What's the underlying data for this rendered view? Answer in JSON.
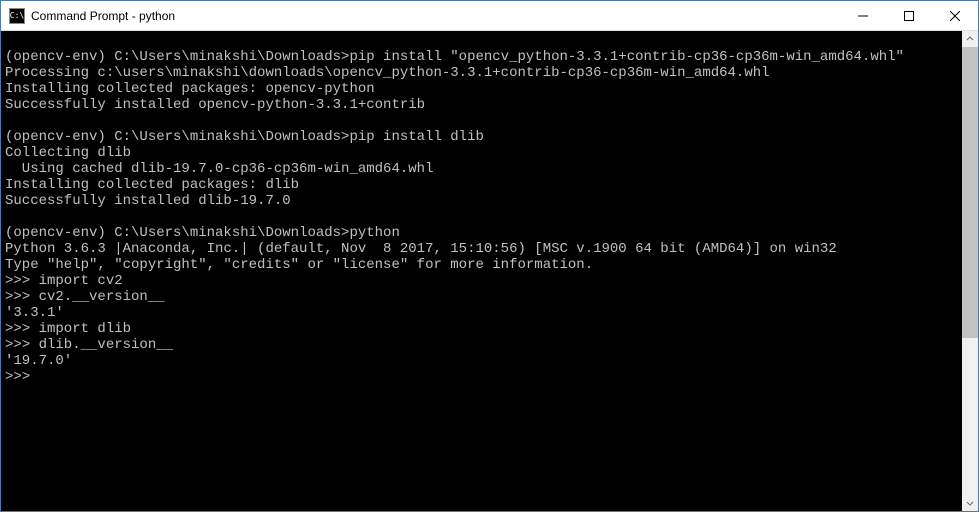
{
  "titlebar": {
    "icon_text": "C:\\",
    "title": "Command Prompt - python"
  },
  "terminal": {
    "lines": [
      "",
      "(opencv-env) C:\\Users\\minakshi\\Downloads>pip install \"opencv_python-3.3.1+contrib-cp36-cp36m-win_amd64.whl\"",
      "Processing c:\\users\\minakshi\\downloads\\opencv_python-3.3.1+contrib-cp36-cp36m-win_amd64.whl",
      "Installing collected packages: opencv-python",
      "Successfully installed opencv-python-3.3.1+contrib",
      "",
      "(opencv-env) C:\\Users\\minakshi\\Downloads>pip install dlib",
      "Collecting dlib",
      "  Using cached dlib-19.7.0-cp36-cp36m-win_amd64.whl",
      "Installing collected packages: dlib",
      "Successfully installed dlib-19.7.0",
      "",
      "(opencv-env) C:\\Users\\minakshi\\Downloads>python",
      "Python 3.6.3 |Anaconda, Inc.| (default, Nov  8 2017, 15:10:56) [MSC v.1900 64 bit (AMD64)] on win32",
      "Type \"help\", \"copyright\", \"credits\" or \"license\" for more information.",
      ">>> import cv2",
      ">>> cv2.__version__",
      "'3.3.1'",
      ">>> import dlib",
      ">>> dlib.__version__",
      "'19.7.0'",
      ">>>"
    ]
  }
}
